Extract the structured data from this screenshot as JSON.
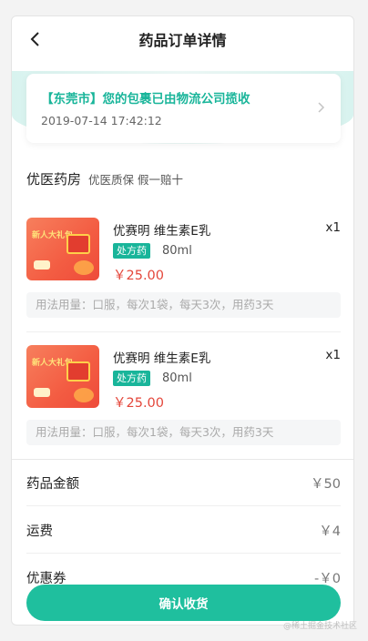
{
  "header": {
    "title": "药品订单详情"
  },
  "status": {
    "text": "【东莞市】您的包裹已由物流公司揽收",
    "time": "2019-07-14 17:42:12"
  },
  "store": {
    "name": "优医药房",
    "tags": "优医质保 假一赔十"
  },
  "items": [
    {
      "thumb_text": "新人大礼包",
      "name": "优赛明 维生素E乳",
      "qty": "x1",
      "badge": "处方药",
      "spec": "80ml",
      "price": "￥25.00",
      "usage": "用法用量：口服，每次1袋，每天3次，用药3天"
    },
    {
      "thumb_text": "新人大礼包",
      "name": "优赛明 维生素E乳",
      "qty": "x1",
      "badge": "处方药",
      "spec": "80ml",
      "price": "￥25.00",
      "usage": "用法用量：口服，每次1袋，每天3次，用药3天"
    }
  ],
  "summary": [
    {
      "label": "药品金额",
      "value": "￥50"
    },
    {
      "label": "运费",
      "value": "￥4"
    },
    {
      "label": "优惠券",
      "value": "-￥0"
    }
  ],
  "actions": {
    "confirm_label": "确认收货"
  },
  "watermark": "@稀土掘金技术社区",
  "colors": {
    "accent": "#19b59a",
    "price": "#e4463a",
    "button": "#1fbf9e"
  }
}
